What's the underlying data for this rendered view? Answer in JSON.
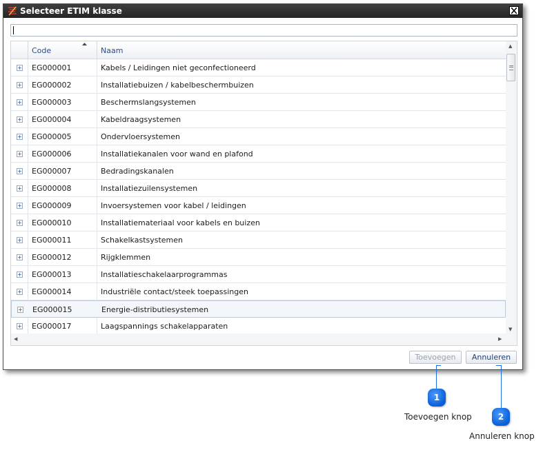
{
  "window": {
    "title": "Selecteer ETIM klasse"
  },
  "search": {
    "value": ""
  },
  "grid": {
    "columns": {
      "code": "Code",
      "name": "Naam"
    },
    "rows": [
      {
        "code": "EG000001",
        "name": "Kabels / Leidingen niet geconfectioneerd"
      },
      {
        "code": "EG000002",
        "name": "Installatiebuizen / kabelbeschermbuizen"
      },
      {
        "code": "EG000003",
        "name": "Beschermslangsystemen"
      },
      {
        "code": "EG000004",
        "name": "Kabeldraagsystemen"
      },
      {
        "code": "EG000005",
        "name": "Ondervloersystemen"
      },
      {
        "code": "EG000006",
        "name": "Installatiekanalen voor wand en plafond"
      },
      {
        "code": "EG000007",
        "name": "Bedradingskanalen"
      },
      {
        "code": "EG000008",
        "name": "Installatiezuilensystemen"
      },
      {
        "code": "EG000009",
        "name": "Invoersystemen voor kabel / leidingen"
      },
      {
        "code": "EG000010",
        "name": "Installatiemateriaal voor kabels en buizen"
      },
      {
        "code": "EG000011",
        "name": "Schakelkastsystemen"
      },
      {
        "code": "EG000012",
        "name": "Rijgklemmen"
      },
      {
        "code": "EG000013",
        "name": "Installatieschakelaarprogrammas"
      },
      {
        "code": "EG000014",
        "name": "Industriële contact/steek toepassingen"
      },
      {
        "code": "EG000015",
        "name": "Energie-distributiesystemen",
        "selected": true
      },
      {
        "code": "EG000017",
        "name": "Laagspannings schakelapparaten"
      }
    ]
  },
  "buttons": {
    "add": "Toevoegen",
    "cancel": "Annuleren"
  },
  "callouts": [
    {
      "number": "1",
      "label": "Toevoegen knop"
    },
    {
      "number": "2",
      "label": "Annuleren knop"
    }
  ]
}
